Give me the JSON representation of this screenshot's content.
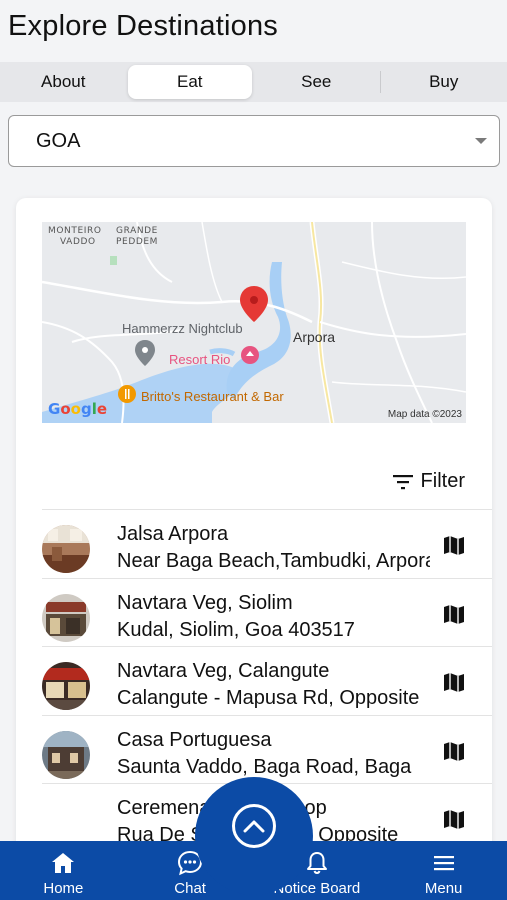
{
  "page": {
    "title": "Explore Destinations"
  },
  "tabs": [
    {
      "label": "About",
      "active": false
    },
    {
      "label": "Eat",
      "active": true
    },
    {
      "label": "See",
      "active": false
    },
    {
      "label": "Buy",
      "active": false
    }
  ],
  "location_select": {
    "value": "GOA"
  },
  "map": {
    "labels": {
      "monteiro": "MONTEIRO",
      "vaddo": "VADDO",
      "grande": "GRANDE",
      "peddem": "PEDDEM",
      "hammerzz": "Hammerzz Nightclub",
      "arpora": "Arpora",
      "resort_rio": "Resort Rio",
      "brittos": "Britto's Restaurant & Bar"
    },
    "google": "Google",
    "credit": "Map data ©2023"
  },
  "filter": {
    "label": "Filter"
  },
  "restaurants": [
    {
      "name": "Jalsa Arpora",
      "address": "Near Baga Beach,Tambudki, Arpora, Goa"
    },
    {
      "name": "Navtara Veg, Siolim",
      "address": "Kudal, Siolim, Goa 403517"
    },
    {
      "name": "Navtara Veg, Calangute",
      "address": "Calangute - Mapusa Rd, Opposite"
    },
    {
      "name": "Casa Portuguesa",
      "address": "Saunta Vaddo, Baga Road, Baga"
    },
    {
      "name": "Ceremena Coffee Shop",
      "address": "Rua De Saint Agostin, Opposite"
    }
  ],
  "bottom_nav": {
    "home": "Home",
    "chat": "Chat",
    "notice": "Notice Board",
    "menu": "Menu"
  },
  "colors": {
    "brand": "#0c4ba6",
    "pin": "#e53935"
  }
}
